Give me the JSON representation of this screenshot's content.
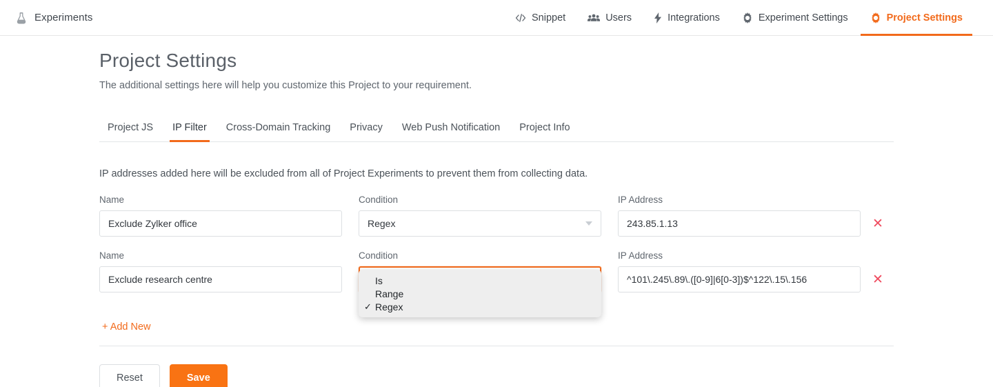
{
  "topnav": {
    "brand": {
      "icon": "flask-icon",
      "label": "Experiments"
    },
    "items": [
      {
        "label": "Snippet",
        "icon": "code-icon",
        "active": false
      },
      {
        "label": "Users",
        "icon": "users-icon",
        "active": false
      },
      {
        "label": "Integrations",
        "icon": "bolt-icon",
        "active": false
      },
      {
        "label": "Experiment Settings",
        "icon": "gear-icon",
        "active": false
      },
      {
        "label": "Project Settings",
        "icon": "gear-icon",
        "active": true
      }
    ]
  },
  "page": {
    "title": "Project Settings",
    "subtitle": "The additional settings here will help you customize this Project to your requirement."
  },
  "tabs": [
    {
      "label": "Project JS",
      "active": false
    },
    {
      "label": "IP Filter",
      "active": true
    },
    {
      "label": "Cross-Domain Tracking",
      "active": false
    },
    {
      "label": "Privacy",
      "active": false
    },
    {
      "label": "Web Push Notification",
      "active": false
    },
    {
      "label": "Project Info",
      "active": false
    }
  ],
  "ip_filter": {
    "description": "IP addresses added here will be excluded from all of Project Experiments to prevent them from collecting data.",
    "labels": {
      "name": "Name",
      "condition": "Condition",
      "ip_address": "IP Address"
    },
    "rows": [
      {
        "name": "Exclude Zylker office",
        "condition": "Regex",
        "ip_address": "243.85.1.13",
        "remove_icon": "close-icon",
        "focused": false
      },
      {
        "name": "Exclude research centre",
        "condition": "Regex",
        "ip_address": "^101\\.245\\.89\\.([0-9]|6[0-3])$^122\\.15\\.156",
        "remove_icon": "close-icon",
        "focused": true
      }
    ],
    "add_new": "+ Add New",
    "condition_dropdown": {
      "open": true,
      "selected": "Regex",
      "check_glyph": "✓",
      "options": [
        {
          "label": "Is",
          "selected": false
        },
        {
          "label": "Range",
          "selected": false
        },
        {
          "label": "Regex",
          "selected": true
        }
      ]
    }
  },
  "actions": {
    "reset": "Reset",
    "save": "Save"
  },
  "colors": {
    "accent": "#f26a1b",
    "save_button": "#f97313",
    "remove_icon": "#ef4b5f",
    "text_primary": "#32373d",
    "text_secondary": "#5f666e",
    "border": "#dcdfe2",
    "dropdown_bg": "#eeeeee"
  }
}
